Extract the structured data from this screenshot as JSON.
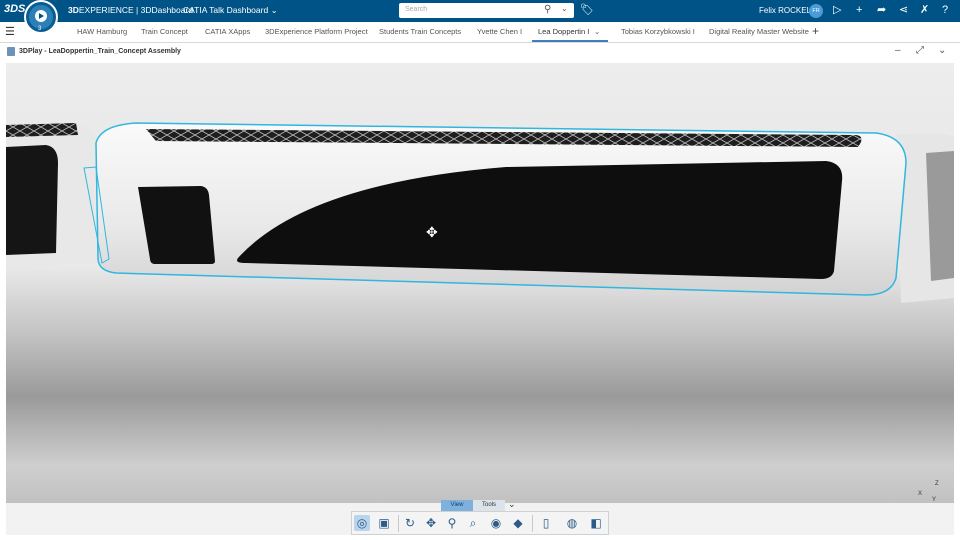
{
  "header": {
    "brand_bold": "3D",
    "brand_rest": "EXPERIENCE | 3DDashboard",
    "dashboard_name": "CATIA Talk Dashboard",
    "search_placeholder": "Search",
    "user_name": "Felix ROCKEL",
    "avatar_initials": "FR"
  },
  "tabs": [
    {
      "label": "HAW Hamburg"
    },
    {
      "label": "Train Concept"
    },
    {
      "label": "CATIA XApps"
    },
    {
      "label": "3DExperience Platform Project"
    },
    {
      "label": "Students Train Concepts"
    },
    {
      "label": "Yvette Chen I"
    },
    {
      "label": "Lea Doppertin I",
      "active": true
    },
    {
      "label": "Tobias Korzybkowski I"
    },
    {
      "label": "Digital Reality Master Website"
    }
  ],
  "widget": {
    "title": "3DPlay - LeaDoppertin_Train_Concept Assembly"
  },
  "viewer": {
    "axis_labels": {
      "z": "Z",
      "x": "X",
      "y": "Y"
    },
    "bottom_tabs": {
      "view": "View",
      "tools": "Tools"
    }
  },
  "action_bar_icons": [
    "fit-all-icon",
    "camera-views-icon",
    "rotate-icon",
    "pan-icon",
    "zoom-area-icon",
    "zoom-icon",
    "look-at-icon",
    "render-style-icon",
    "section-icon",
    "visibility-icon",
    "panel-icon"
  ],
  "colors": {
    "brand_blue": "#005386",
    "selection_outline": "#31b6dd",
    "active_tab": "#3d7fbf"
  }
}
